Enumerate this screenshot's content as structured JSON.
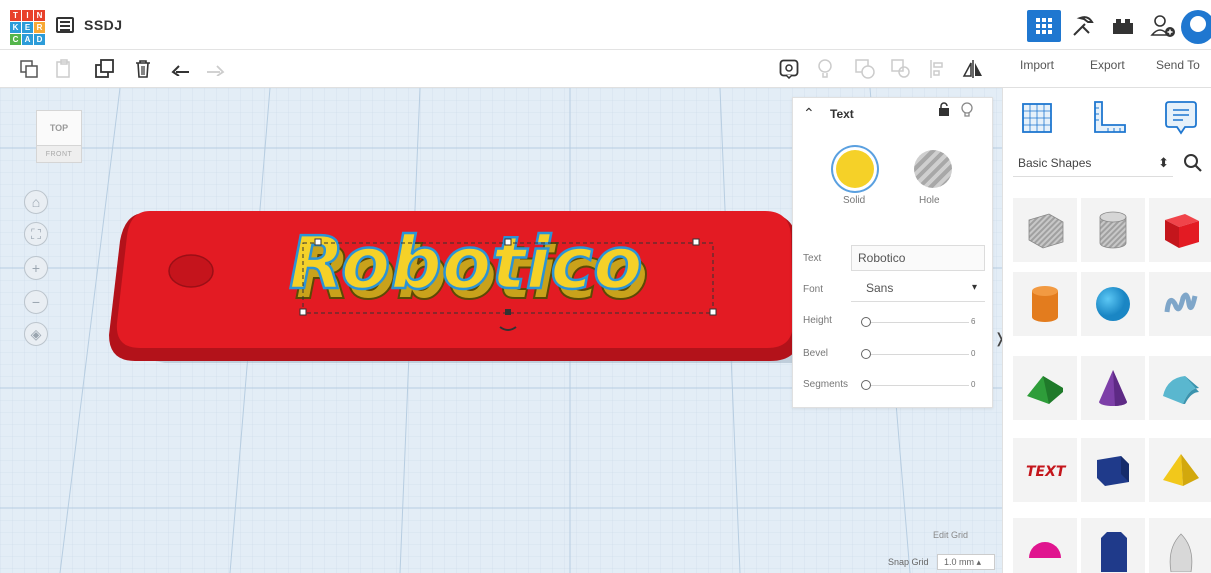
{
  "app": {
    "logo_letters": [
      "T",
      "I",
      "N",
      "K",
      "E",
      "R",
      "C",
      "A",
      "D"
    ],
    "logo_colors": [
      "#e8412b",
      "#e8412b",
      "#e8412b",
      "#2c9cd9",
      "#2c9cd9",
      "#f7a834",
      "#54b54c",
      "#2c9cd9",
      "#2c9cd9"
    ],
    "design_name": "SSDJ",
    "top_icons": [
      "grid-view-icon",
      "tinker-icon",
      "bricks-icon",
      "add-user-icon",
      "user-avatar"
    ]
  },
  "toolbar": {
    "tools": [
      "copy-icon",
      "paste-icon",
      "duplicate-icon",
      "delete-icon",
      "undo-icon",
      "redo-icon"
    ],
    "right_tools": [
      "note-icon",
      "light-icon",
      "group-icon",
      "ungroup-icon",
      "align-icon",
      "mirror-icon"
    ]
  },
  "actions": {
    "import": "Import",
    "export": "Export",
    "send_to": "Send To"
  },
  "viewcube": {
    "top": "TOP",
    "front": "FRONT"
  },
  "model": {
    "text": "Robotico",
    "base_color": "#e31b23",
    "text_color": "#f5d128"
  },
  "inspector": {
    "title": "Text",
    "solid_label": "Solid",
    "hole_label": "Hole",
    "solid_color": "#f5d128",
    "props": {
      "text_label": "Text",
      "text_value": "Robotico",
      "font_label": "Font",
      "font_value": "Sans",
      "height_label": "Height",
      "height_value": "6",
      "bevel_label": "Bevel",
      "bevel_value": "0",
      "segments_label": "Segments",
      "segments_value": "0"
    }
  },
  "grid": {
    "edit_label": "Edit Grid",
    "snap_label": "Snap Grid",
    "snap_value": "1.0 mm"
  },
  "shapes_panel": {
    "category": "Basic Shapes",
    "shapes": [
      "box-hole",
      "cylinder-hole",
      "box",
      "cylinder",
      "sphere",
      "scribble",
      "roof",
      "cone",
      "round-roof",
      "text",
      "polygon",
      "pyramid",
      "half-sphere",
      "paraboloid",
      "egg"
    ]
  }
}
